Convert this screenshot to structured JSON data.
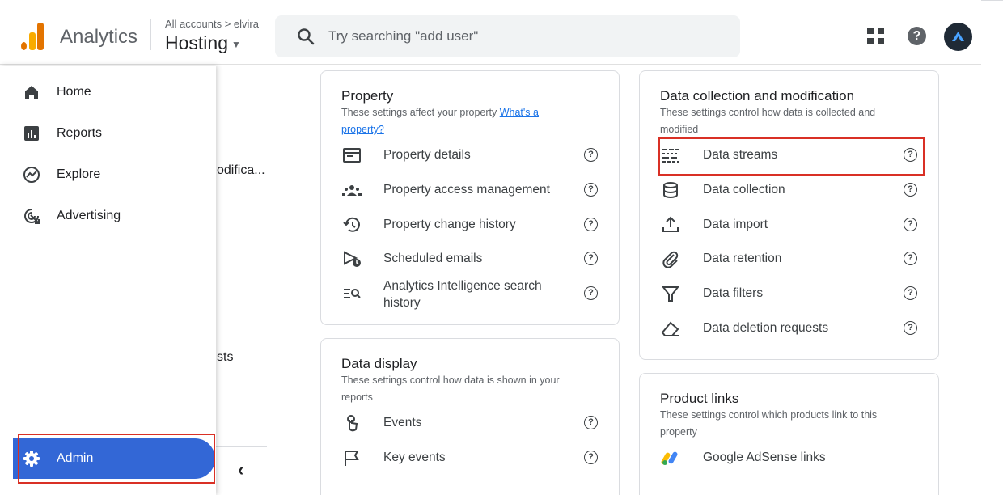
{
  "header": {
    "app_title": "Analytics",
    "breadcrumb": "All accounts > elvira",
    "property_name": "Hosting",
    "search_placeholder": "Try searching \"add user\"",
    "brand_colors": {
      "orange": "#f9ab00",
      "dark_orange": "#e37400"
    }
  },
  "background": {
    "truncated_item_1": "odifica...",
    "truncated_item_2": "sts"
  },
  "sidebar": {
    "items": [
      {
        "label": "Home",
        "icon": "home-icon"
      },
      {
        "label": "Reports",
        "icon": "bar-chart-icon"
      },
      {
        "label": "Explore",
        "icon": "explore-icon"
      },
      {
        "label": "Advertising",
        "icon": "advertising-icon"
      }
    ],
    "admin": {
      "label": "Admin",
      "icon": "gear-icon",
      "active_color": "#3367d6"
    }
  },
  "property_card": {
    "title": "Property",
    "desc_prefix": "These settings affect your property ",
    "desc_link": "What's a property?",
    "rows": [
      {
        "label": "Property details",
        "icon": "property-details-icon"
      },
      {
        "label": "Property access management",
        "icon": "people-icon"
      },
      {
        "label": "Property change history",
        "icon": "history-icon"
      },
      {
        "label": "Scheduled emails",
        "icon": "scheduled-email-icon"
      },
      {
        "label": "Analytics Intelligence search history",
        "icon": "search-history-icon"
      }
    ]
  },
  "data_display_card": {
    "title": "Data display",
    "desc": "These settings control how data is shown in your reports",
    "rows": [
      {
        "label": "Events",
        "icon": "touch-icon"
      },
      {
        "label": "Key events",
        "icon": "flag-icon"
      }
    ]
  },
  "data_collection_card": {
    "title": "Data collection and modification",
    "desc": "These settings control how data is collected and modified",
    "rows": [
      {
        "label": "Data streams",
        "icon": "data-streams-icon"
      },
      {
        "label": "Data collection",
        "icon": "database-icon"
      },
      {
        "label": "Data import",
        "icon": "upload-icon"
      },
      {
        "label": "Data retention",
        "icon": "paperclip-icon"
      },
      {
        "label": "Data filters",
        "icon": "filter-icon"
      },
      {
        "label": "Data deletion requests",
        "icon": "eraser-icon"
      }
    ]
  },
  "product_links_card": {
    "title": "Product links",
    "desc": "These settings control which products link to this property",
    "rows": [
      {
        "label": "Google AdSense links",
        "icon": "adsense-icon"
      }
    ]
  },
  "highlight_color": "#d93025"
}
